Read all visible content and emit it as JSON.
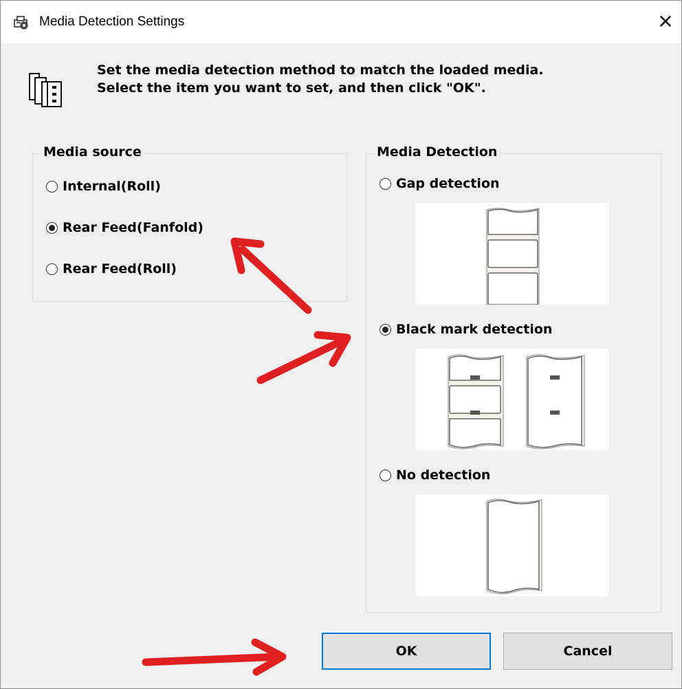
{
  "window": {
    "title": "Media Detection Settings",
    "close_glyph": "✕",
    "icon": "printer-settings-icon"
  },
  "header": {
    "icon": "media-roll-icon",
    "line1": "Set the media detection method to match the loaded media.",
    "line2": "Select the item you want to set, and then click \"OK\"."
  },
  "media_source": {
    "title": "Media source",
    "options": [
      {
        "label": "Internal(Roll)",
        "checked": false
      },
      {
        "label": "Rear Feed(Fanfold)",
        "checked": true
      },
      {
        "label": "Rear Feed(Roll)",
        "checked": false
      }
    ]
  },
  "media_detection": {
    "title": "Media Detection",
    "options": [
      {
        "label": "Gap detection",
        "checked": false,
        "preview": "gap-labels-image"
      },
      {
        "label": "Black mark detection",
        "checked": true,
        "preview": "black-mark-media-image"
      },
      {
        "label": "No detection",
        "checked": false,
        "preview": "continuous-media-image"
      }
    ]
  },
  "buttons": {
    "ok_label": "OK",
    "cancel_label": "Cancel"
  },
  "annotations": {
    "arrow_color": "#e02020"
  },
  "colors": {
    "accent": "#0078d7",
    "dialog_bg": "#f0f0f0"
  }
}
